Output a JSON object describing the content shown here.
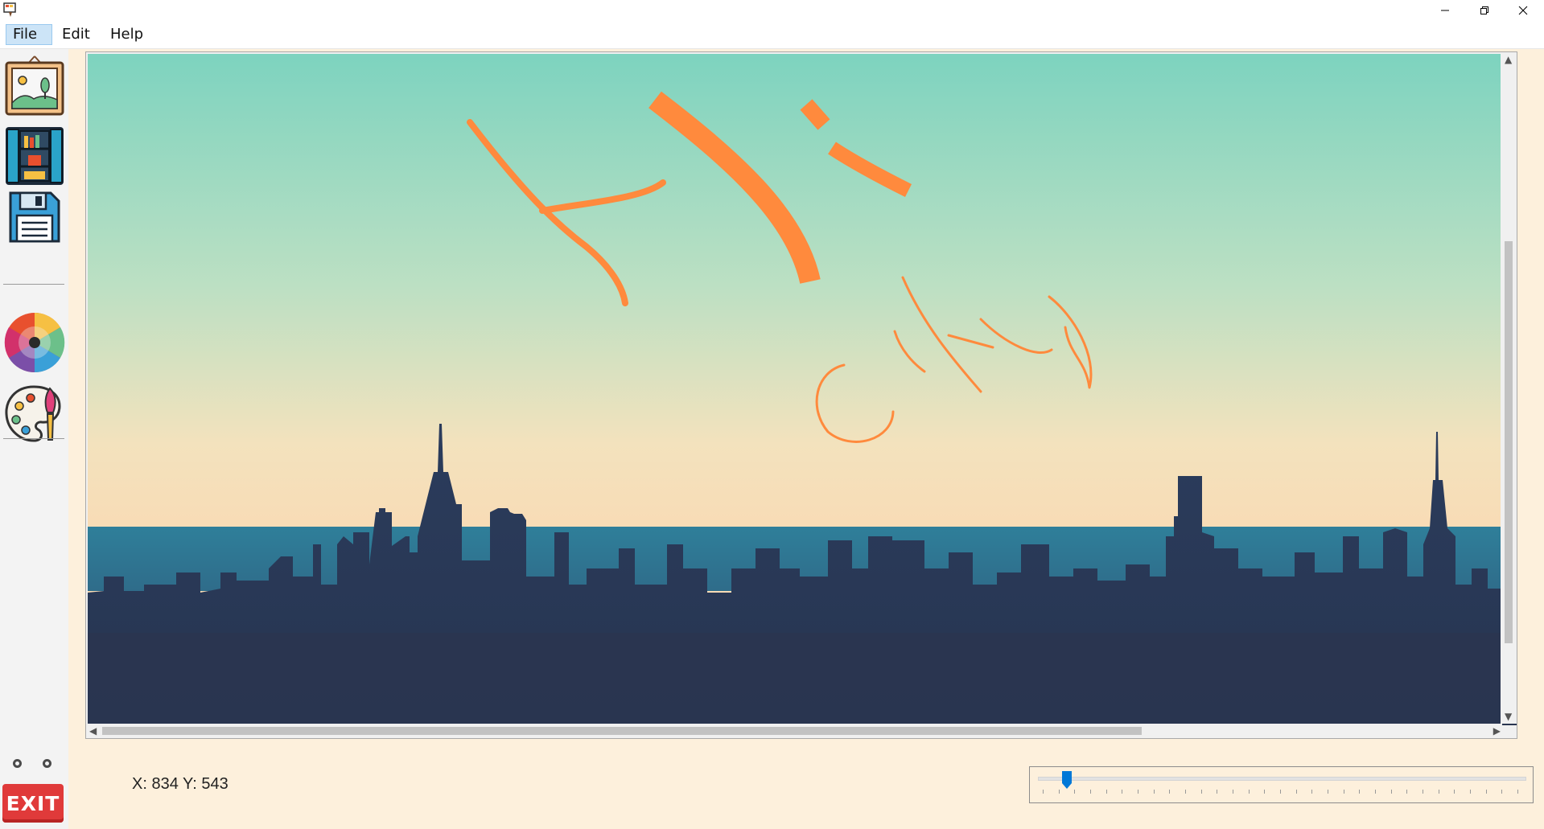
{
  "window": {
    "app_icon": "paint-app-icon",
    "controls": [
      "minimize-icon",
      "restore-icon",
      "close-icon"
    ]
  },
  "menu": {
    "items": [
      {
        "label": "File",
        "active": true
      },
      {
        "label": "Edit",
        "active": false
      },
      {
        "label": "Help",
        "active": false
      }
    ]
  },
  "toolbar": {
    "tools": [
      {
        "name": "open-image-tool",
        "icon": "picture-frame-icon"
      },
      {
        "name": "gallery-tool",
        "icon": "bookshelf-icon"
      },
      {
        "name": "save-tool",
        "icon": "floppy-disk-icon"
      },
      {
        "name": "color-wheel-tool",
        "icon": "color-wheel-icon"
      },
      {
        "name": "palette-tool",
        "icon": "paint-palette-icon"
      }
    ],
    "exit_label": "EXIT"
  },
  "canvas": {
    "image": "city-skyline-photo",
    "stroke_color": "#ff8a3d"
  },
  "status": {
    "coords": "X: 834  Y: 543"
  },
  "brush_slider": {
    "value_fraction": 0.05
  },
  "colors": {
    "accent": "#0078d7",
    "exit": "#e03a3a",
    "background": "#fdf0dc"
  }
}
